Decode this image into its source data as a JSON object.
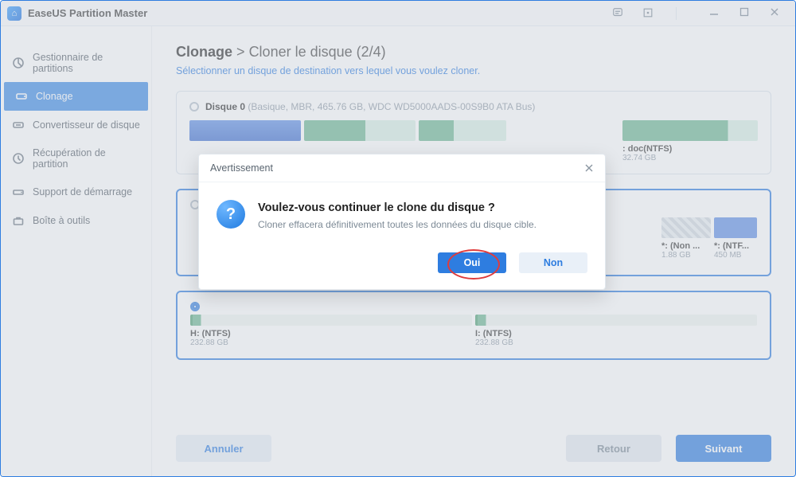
{
  "titlebar": {
    "app_name": "EaseUS Partition Master"
  },
  "sidebar": {
    "items": [
      {
        "label": "Gestionnaire de partitions"
      },
      {
        "label": "Clonage"
      },
      {
        "label": "Convertisseur de disque"
      },
      {
        "label": "Récupération de partition"
      },
      {
        "label": "Support de démarrage"
      },
      {
        "label": "Boîte à outils"
      }
    ]
  },
  "header": {
    "crumb_main": "Clonage",
    "crumb_sep": ">",
    "crumb_sub": "Cloner le disque (2/4)",
    "subtitle": "Sélectionner un disque de destination vers lequel vous voulez cloner."
  },
  "disks": {
    "d0": {
      "title": "Disque 0",
      "meta": "(Basique, MBR, 465.76 GB, WDC WD5000AADS-00S9B0 ATA Bus)",
      "part_doc_label": ": doc(NTFS)",
      "part_doc_size": "32.74 GB"
    },
    "d1": {
      "part_nonalloc_label": "*: (Non ...",
      "part_nonalloc_size": "1.88 GB",
      "part_ntf_label": "*: (NTF...",
      "part_ntf_size": "450 MB"
    },
    "d2": {
      "h_label": "H: (NTFS)",
      "h_size": "232.88 GB",
      "i_label": "I: (NTFS)",
      "i_size": "232.88 GB"
    }
  },
  "footer": {
    "cancel": "Annuler",
    "back": "Retour",
    "next": "Suivant"
  },
  "modal": {
    "title": "Avertissement",
    "heading": "Voulez-vous continuer le clone du disque ?",
    "message": "Cloner effacera définitivement toutes les données du disque cible.",
    "yes": "Oui",
    "no": "Non"
  }
}
